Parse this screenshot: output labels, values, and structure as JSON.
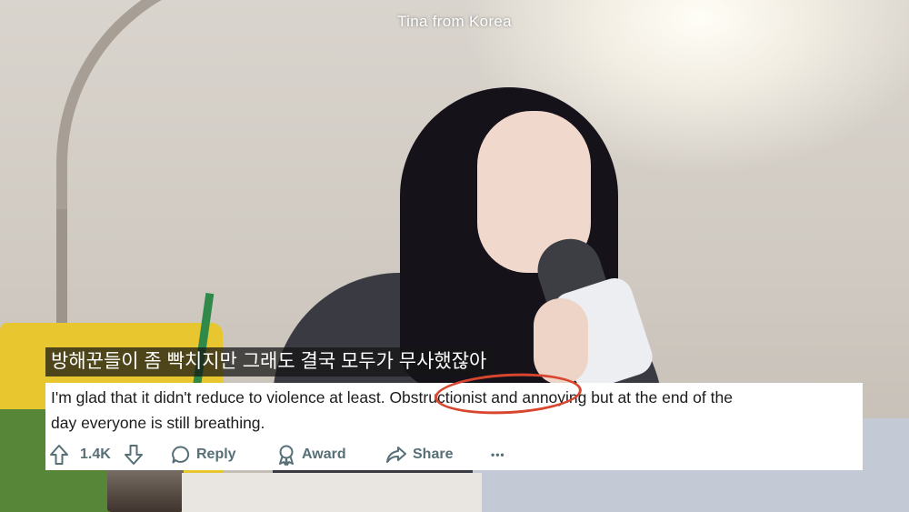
{
  "video": {
    "channel_name": "Tina from Korea",
    "subtitle_korean": "방해꾼들이 좀 빡치지만 그래도 결국 모두가 무사했잖아"
  },
  "comment": {
    "text_line1": "I'm glad that it didn't reduce to violence at least. Obstructionist and annoying but at the end of the",
    "text_line2": "day everyone is still breathing.",
    "highlighted_word": "Obstructionist",
    "highlight_color": "#d9462f"
  },
  "actions": {
    "vote_count": "1.4K",
    "reply_label": "Reply",
    "award_label": "Award",
    "share_label": "Share",
    "more_label": "•••",
    "icon_color": "#576f76"
  }
}
